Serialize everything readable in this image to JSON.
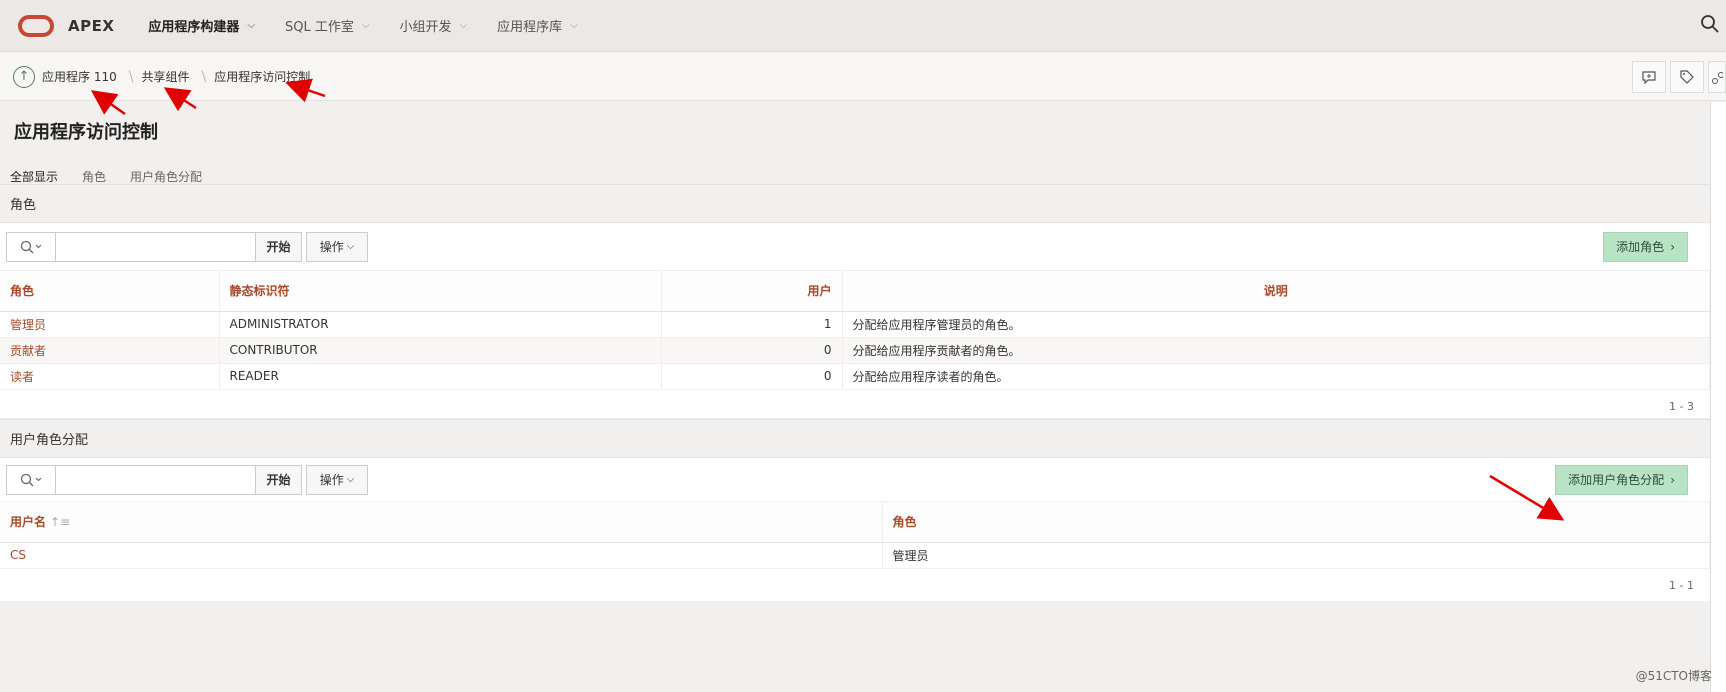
{
  "topnav": {
    "logo_text": "APEX",
    "items": [
      {
        "label": "应用程序构建器"
      },
      {
        "label": "SQL 工作室"
      },
      {
        "label": "小组开发"
      },
      {
        "label": "应用程序库"
      }
    ]
  },
  "breadcrumb": {
    "items": [
      {
        "label": "应用程序 110"
      },
      {
        "label": "共享组件"
      },
      {
        "label": "应用程序访问控制"
      }
    ]
  },
  "page": {
    "title": "应用程序访问控制",
    "tabs": [
      {
        "label": "全部显示"
      },
      {
        "label": "角色"
      },
      {
        "label": "用户角色分配"
      }
    ]
  },
  "roles_region": {
    "title": "角色",
    "go_label": "开始",
    "actions_label": "操作",
    "add_label": "添加角色",
    "columns": {
      "role": "角色",
      "static_id": "静态标识符",
      "users": "用户",
      "description": "说明"
    },
    "rows": [
      {
        "role": "管理员",
        "static_id": "ADMINISTRATOR",
        "users": "1",
        "description": "分配给应用程序管理员的角色。"
      },
      {
        "role": "贡献者",
        "static_id": "CONTRIBUTOR",
        "users": "0",
        "description": "分配给应用程序贡献者的角色。"
      },
      {
        "role": "读者",
        "static_id": "READER",
        "users": "0",
        "description": "分配给应用程序读者的角色。"
      }
    ],
    "pagination": "1 - 3"
  },
  "assign_region": {
    "title": "用户角色分配",
    "go_label": "开始",
    "actions_label": "操作",
    "add_label": "添加用户角色分配",
    "columns": {
      "username": "用户名",
      "role": "角色"
    },
    "rows": [
      {
        "username": "CS",
        "role": "管理员"
      }
    ],
    "pagination": "1 - 1"
  },
  "watermark": "@51CTO博客",
  "colors": {
    "accent": "#a64b2a",
    "add_button": "#b8e3c5",
    "arrow": "#e00000",
    "oracle_red": "#c74634"
  }
}
